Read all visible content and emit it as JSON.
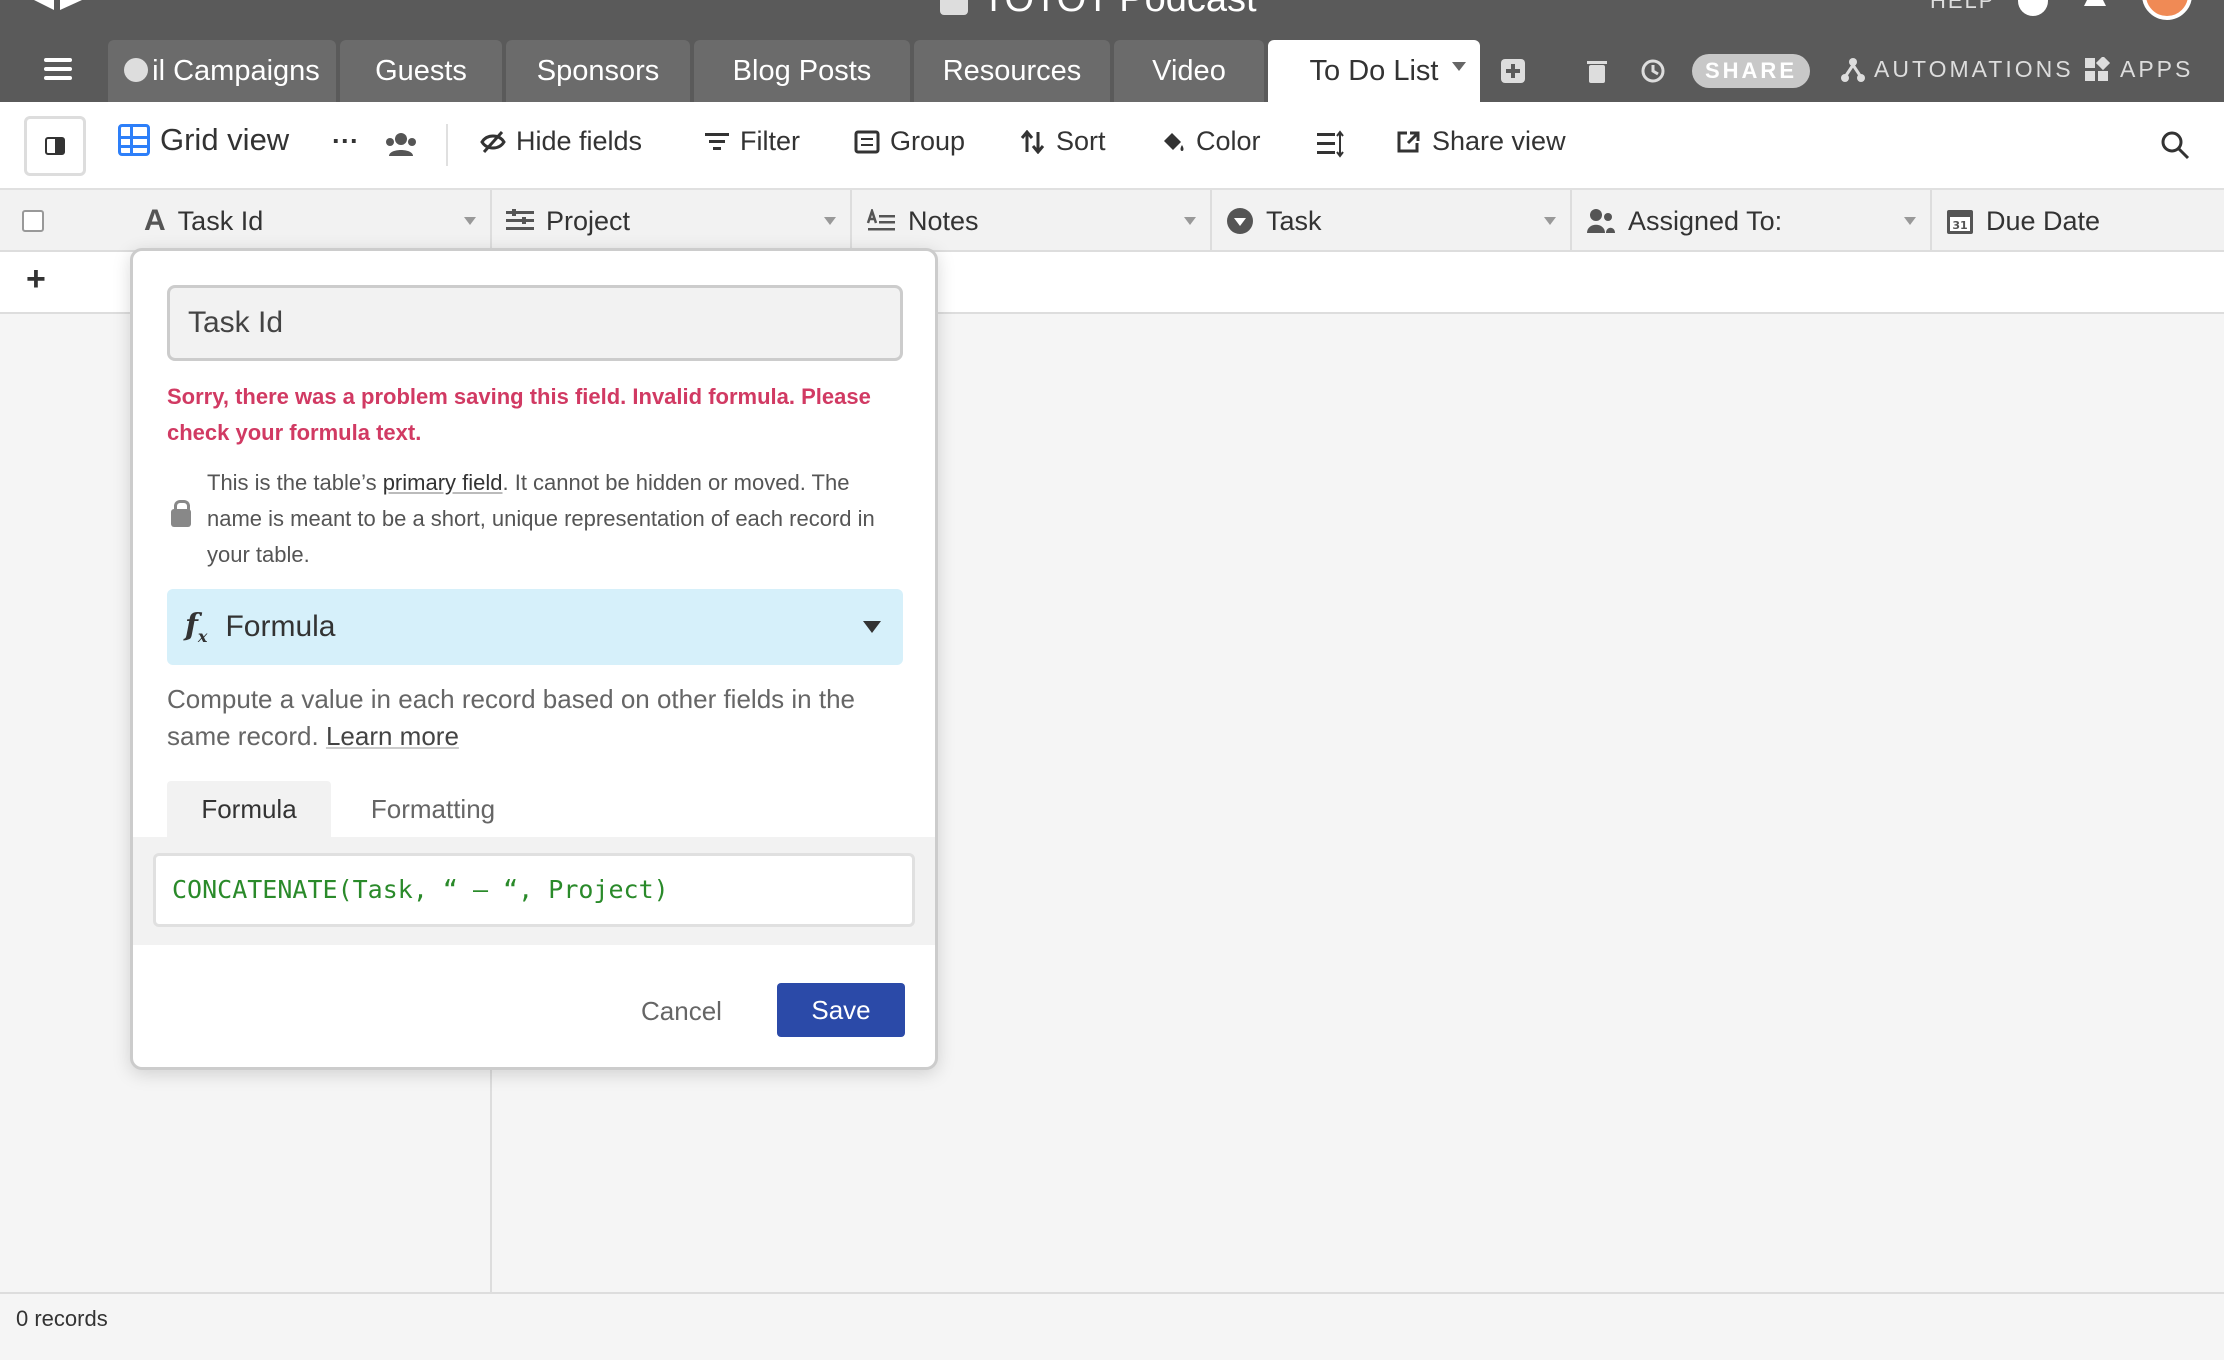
{
  "base": {
    "title": "TOTOT Podcast",
    "help_label": "HELP"
  },
  "tabs": [
    {
      "label": "il Campaigns"
    },
    {
      "label": "Guests"
    },
    {
      "label": "Sponsors"
    },
    {
      "label": "Blog Posts"
    },
    {
      "label": "Resources"
    },
    {
      "label": "Video"
    },
    {
      "label": "To Do List"
    }
  ],
  "top_actions": {
    "share": "SHARE",
    "automations": "AUTOMATIONS",
    "apps": "APPS"
  },
  "toolbar": {
    "view_name": "Grid view",
    "more": "···",
    "hide_fields": "Hide fields",
    "filter": "Filter",
    "group": "Group",
    "sort": "Sort",
    "color": "Color",
    "share_view": "Share view"
  },
  "columns": [
    {
      "label": "Task Id"
    },
    {
      "label": "Project"
    },
    {
      "label": "Notes"
    },
    {
      "label": "Task"
    },
    {
      "label": "Assigned To:"
    },
    {
      "label": "Due Date"
    }
  ],
  "grid": {
    "add_row": "+",
    "record_count": "0 records"
  },
  "field_editor": {
    "field_name": "Task Id",
    "error": "Sorry, there was a problem saving this field. Invalid formula. Please check your formula text.",
    "primary_note_pre": "This is the table’s ",
    "primary_note_link": "primary field",
    "primary_note_post": ". It cannot be hidden or moved. The name is meant to be a short, unique representation of each record in your table.",
    "field_type": "Formula",
    "description": "Compute a value in each record based on other fields in the same record. ",
    "learn_more": "Learn more",
    "subtabs": [
      "Formula",
      "Formatting"
    ],
    "formula": "CONCATENATE(Task, “ – “, Project)",
    "cancel": "Cancel",
    "save": "Save"
  },
  "colors": {
    "accent": "#2d7ff9",
    "save": "#2b4aa8",
    "error": "#d13a63",
    "formula_text": "#2a8a2a",
    "type_bg": "#d6f0fa"
  }
}
